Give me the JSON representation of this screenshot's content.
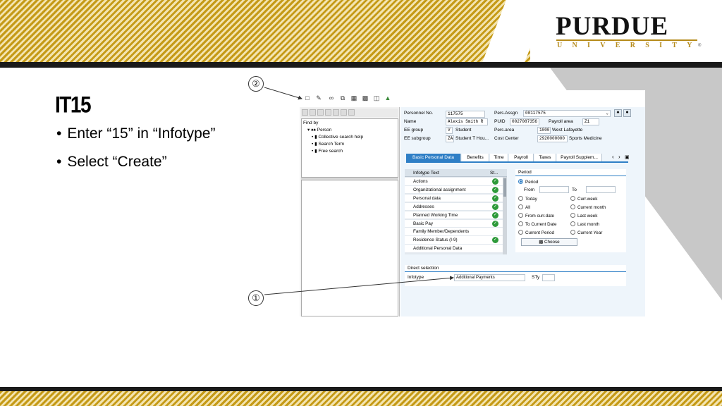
{
  "logo": {
    "name": "PURDUE",
    "sub": "UNIVERSITY",
    "mark": "®"
  },
  "slide": {
    "title": "IT15",
    "bullets": [
      "Enter “15” in “Infotype”",
      "Select “Create”"
    ],
    "callouts": [
      "②",
      "①"
    ]
  },
  "sap": {
    "nav": {
      "find_by": "Find by",
      "person": "Person",
      "items": [
        "Collective search help",
        "Search Term",
        "Free search"
      ]
    },
    "header": {
      "personnel_no_label": "Personnel No.",
      "personnel_no": "117575",
      "pers_assgn_label": "Pers.Assgn",
      "pers_assgn": "00117575",
      "name_label": "Name",
      "name": "Alexis Smith R",
      "puid_label": "PUID",
      "puid": "0027087356",
      "payroll_area_label": "Payroll area",
      "payroll_area": "Z1",
      "ee_group_label": "EE group",
      "ee_group_code": "V",
      "ee_group": "Student",
      "pers_area_label": "Pers.area",
      "pers_area_code": "1000",
      "pers_area": "West Lafayette",
      "ee_subgroup_label": "EE subgroup",
      "ee_subgroup_code": "ZA",
      "ee_subgroup": "Student T Hou...",
      "cost_center_label": "Cost Center",
      "cost_center_code": "2920000000",
      "cost_center": "Sports Medicine"
    },
    "tabs": [
      "Basic Personal Data",
      "Benefits",
      "Time",
      "Payroll",
      "Taxes",
      "Payroll Supplem..."
    ],
    "infotype_table": {
      "col_text": "Infotype Text",
      "col_status": "St...",
      "rows": [
        {
          "label": "Actions",
          "check": true
        },
        {
          "label": "Organizational assignment",
          "check": true
        },
        {
          "label": "Personal data",
          "check": true
        },
        {
          "label": "Addresses",
          "check": true
        },
        {
          "label": "Planned Working Time",
          "check": true
        },
        {
          "label": "Basic Pay",
          "check": true
        },
        {
          "label": "Family Member/Dependents",
          "check": false
        },
        {
          "label": "Residence Status (I-9)",
          "check": true
        },
        {
          "label": "Additional Personal Data",
          "check": false
        }
      ]
    },
    "period": {
      "title": "Period",
      "selected": "Period",
      "from_label": "From",
      "to_label": "To",
      "options_left": [
        "Today",
        "All",
        "From curr.date",
        "To Current Date",
        "Current Period"
      ],
      "options_right": [
        "Curr.week",
        "Current month",
        "Last week",
        "Last month",
        "Current Year"
      ],
      "choose_label": "Choose"
    },
    "direct_selection": {
      "title": "Direct selection",
      "infotype_label": "Infotype",
      "infotype_value": "Additional Payments",
      "sty_label": "STy"
    }
  },
  "colors": {
    "gold": "#c59a16",
    "sap_blue": "#2f7fc6",
    "check_green": "#2e9a3a"
  }
}
